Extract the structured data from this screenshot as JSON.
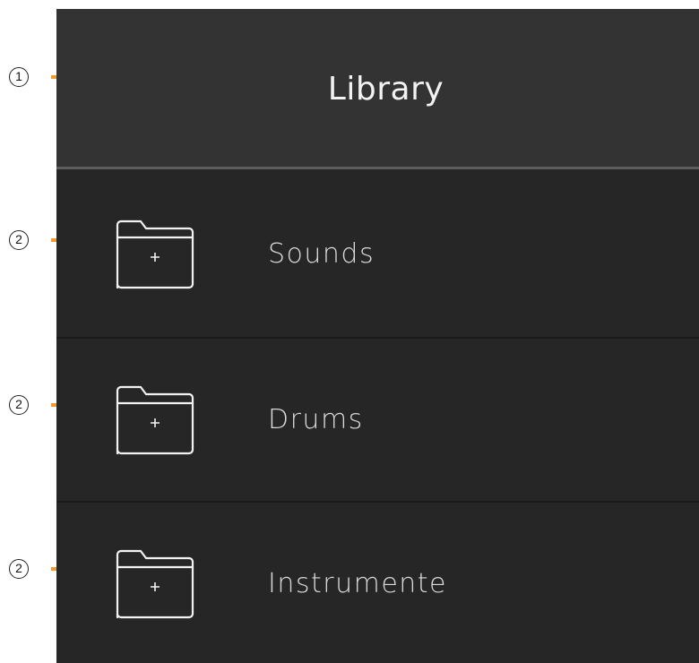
{
  "callouts": [
    {
      "number": "1"
    },
    {
      "number": "2"
    },
    {
      "number": "2"
    },
    {
      "number": "2"
    }
  ],
  "header": {
    "title": "Library"
  },
  "items": [
    {
      "label": "Sounds",
      "icon": "folder-add-icon"
    },
    {
      "label": "Drums",
      "icon": "folder-add-icon"
    },
    {
      "label": "Instrumente",
      "icon": "folder-add-icon"
    }
  ],
  "colors": {
    "callout_tick": "#f39a2c",
    "header_bg": "#333333",
    "list_bg": "#262626",
    "text": "#d9d9d9"
  }
}
